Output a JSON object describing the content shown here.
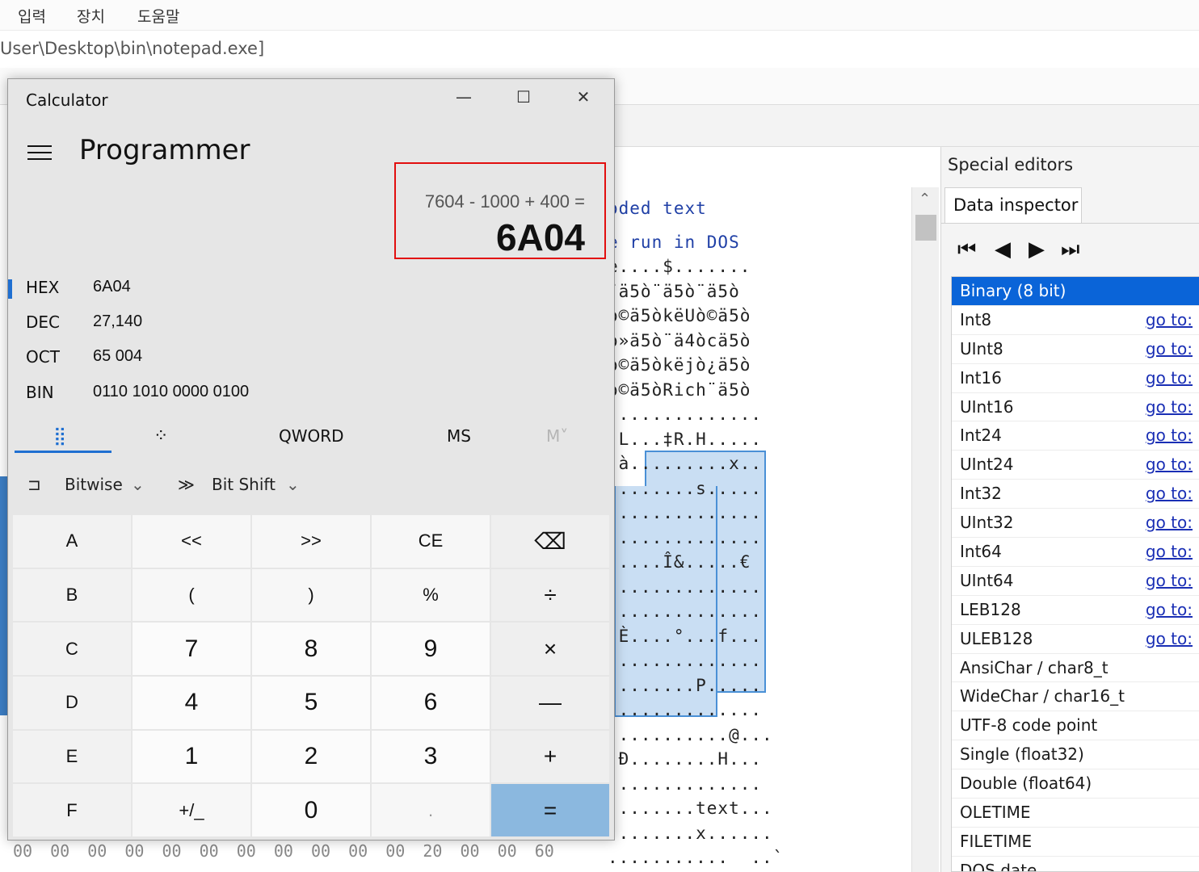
{
  "bg_app": {
    "menu": [
      "입력",
      "장치",
      "도움말"
    ],
    "path_text": "User\\Desktop\\bin\\notepad.exe]",
    "hex_lines": [
      "oded text",
      "e run in DOS",
      "e....$.......",
      "¨ä5ò¨ä5ò¨ä5ò",
      "ò©ä5òkëUò©ä5ò",
      "ò»ä5ò¨ä4òcä5ò",
      "ò©ä5òkëjò¿ä5ò",
      "ò©ä5òRich¨ä5ò",
      "..............",
      ".L...‡R.H.....",
      ".à.........x..",
      "........s.....",
      "..............",
      "..............",
      ".....Î&.....€",
      "..............",
      "..............",
      ".È....°...f...",
      "..............",
      "........P.....",
      "..............",
      "...........@...",
      ".Ð........H...",
      "..............",
      "........text...",
      "........x......",
      "...........  ..`"
    ],
    "hex_bytes_row": "00 00 00 00 00 00 00 00 00 00 00 20 00 00 60"
  },
  "special_editors": {
    "header": "Special editors",
    "tab": "Data inspector",
    "nav": [
      "first-icon",
      "prev-icon",
      "next-icon",
      "last-icon"
    ],
    "rows": [
      {
        "label": "Binary (8 bit)",
        "go": ""
      },
      {
        "label": "Int8",
        "go": "go to:"
      },
      {
        "label": "UInt8",
        "go": "go to:"
      },
      {
        "label": "Int16",
        "go": "go to:"
      },
      {
        "label": "UInt16",
        "go": "go to:"
      },
      {
        "label": "Int24",
        "go": "go to:"
      },
      {
        "label": "UInt24",
        "go": "go to:"
      },
      {
        "label": "Int32",
        "go": "go to:"
      },
      {
        "label": "UInt32",
        "go": "go to:"
      },
      {
        "label": "Int64",
        "go": "go to:"
      },
      {
        "label": "UInt64",
        "go": "go to:"
      },
      {
        "label": "LEB128",
        "go": "go to:"
      },
      {
        "label": "ULEB128",
        "go": "go to:"
      },
      {
        "label": "AnsiChar / char8_t",
        "go": ""
      },
      {
        "label": "WideChar / char16_t",
        "go": ""
      },
      {
        "label": "UTF-8 code point",
        "go": ""
      },
      {
        "label": "Single (float32)",
        "go": ""
      },
      {
        "label": "Double (float64)",
        "go": ""
      },
      {
        "label": "OLETIME",
        "go": ""
      },
      {
        "label": "FILETIME",
        "go": ""
      },
      {
        "label": "DOS date",
        "go": ""
      }
    ]
  },
  "calculator": {
    "title": "Calculator",
    "mode": "Programmer",
    "expression": "7604 - 1000 + 400 =",
    "result": "6A04",
    "radix": [
      {
        "label": "HEX",
        "value": "6A04"
      },
      {
        "label": "DEC",
        "value": "27,140"
      },
      {
        "label": "OCT",
        "value": "65 004"
      },
      {
        "label": "BIN",
        "value": "0110 1010 0000 0100"
      }
    ],
    "word_size": "QWORD",
    "ms": "MS",
    "mrecall": "M˅",
    "bitwise": "Bitwise",
    "bitshift": "Bit Shift",
    "keys": [
      [
        "A",
        "<<",
        ">>",
        "CE",
        "⌫"
      ],
      [
        "B",
        "(",
        ")",
        "%",
        "÷"
      ],
      [
        "C",
        "7",
        "8",
        "9",
        "×"
      ],
      [
        "D",
        "4",
        "5",
        "6",
        "—"
      ],
      [
        "E",
        "1",
        "2",
        "3",
        "+"
      ],
      [
        "F",
        "+/_",
        "0",
        ".",
        "="
      ]
    ]
  },
  "colors": {
    "accent": "#1f6fd1",
    "highlight_box": "#e20f0f",
    "equals_key": "#8bb8df",
    "inspector_selected": "#0a64d8",
    "selection_fill": "#c9def3"
  }
}
